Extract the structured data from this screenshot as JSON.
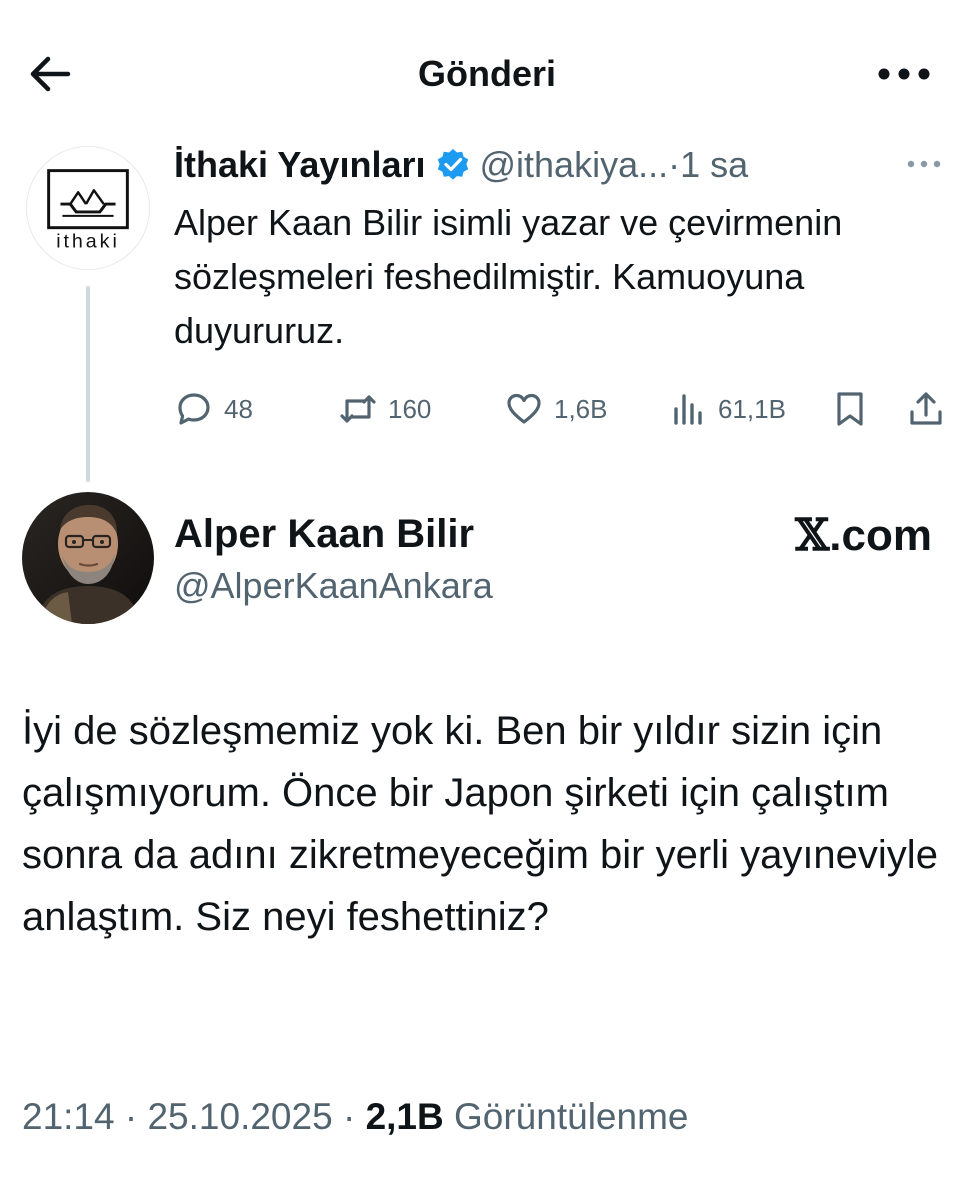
{
  "header": {
    "title": "Gönderi",
    "back_icon": "arrow-left-icon",
    "more_icon": "more-horizontal-icon"
  },
  "quoted_tweet": {
    "author_name": "İthaki Yayınları",
    "verified": true,
    "handle": "@ithakiya...",
    "time_separator": "·",
    "time": "1 sa",
    "avatar_text": "ithaki",
    "text": "Alper Kaan Bilir isimli yazar ve çevirmenin sözleşmeleri feshedilmiştir. Kamuoyuna duyururuz.",
    "stats": {
      "replies": "48",
      "retweets": "160",
      "likes": "1,6B",
      "views": "61,1B"
    }
  },
  "main_tweet": {
    "author_name": "Alper Kaan Bilir",
    "handle": "@AlperKaanAnkara",
    "watermark_x": "𝕏",
    "watermark_rest": ".com",
    "text": "İyi de sözleşmemiz yok ki. Ben bir yıldır sizin için çalışmıyorum. Önce bir Japon şirketi için çalıştım sonra da adını zikretmeyeceğim bir yerli yayıneviyle anlaştım. Siz neyi feshettiniz?",
    "time": "21:14",
    "separator": "·",
    "date": "25.10.2025",
    "views_count": "2,1B",
    "views_label": "Görüntülenme"
  },
  "colors": {
    "text": "#0f1419",
    "muted": "#536471",
    "verified_blue": "#1d9bf0",
    "thread_line": "#cfd9de"
  }
}
